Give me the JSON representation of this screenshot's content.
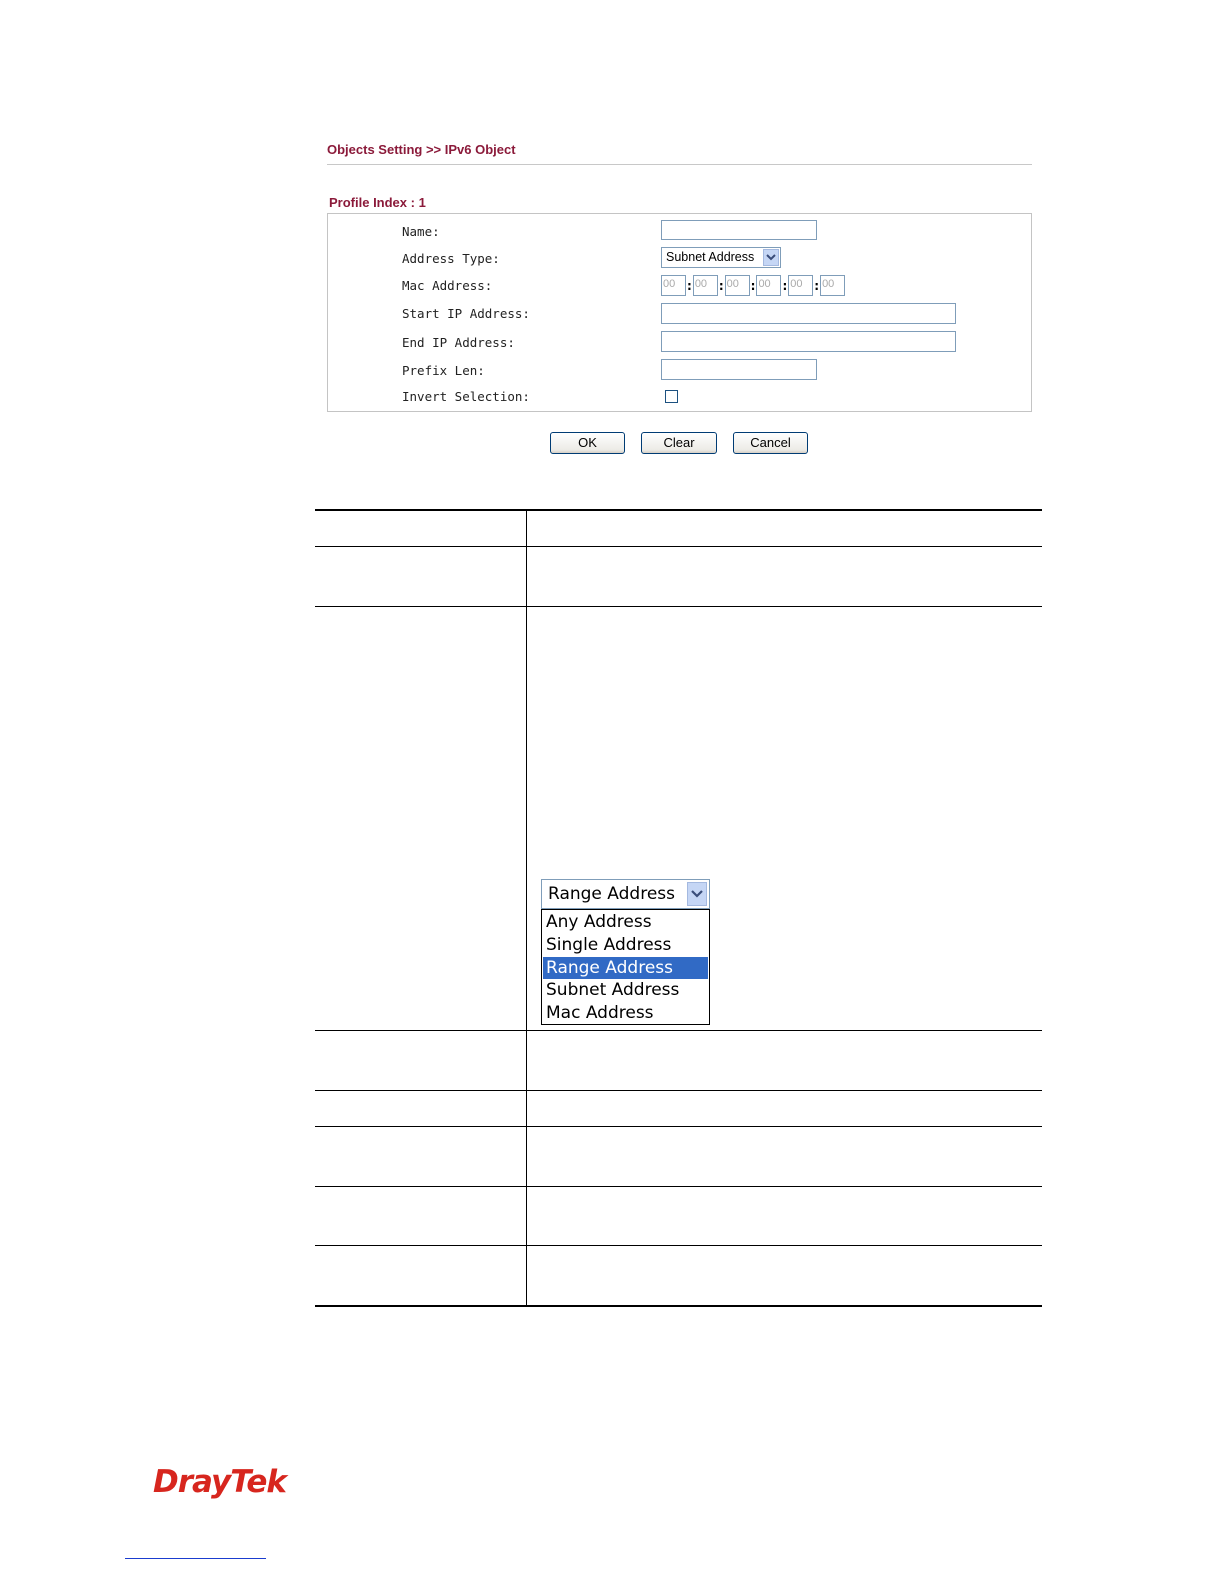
{
  "header": {
    "breadcrumb": "Objects Setting >> IPv6 Object",
    "profile_index": "Profile Index : 1"
  },
  "form": {
    "name_label": "Name:",
    "address_type_label": "Address Type:",
    "address_type_value": "Subnet Address",
    "mac_label": "Mac Address:",
    "mac_octets": [
      "00",
      "00",
      "00",
      "00",
      "00",
      "00"
    ],
    "mac_separator": ":",
    "start_ip_label": "Start IP Address:",
    "end_ip_label": "End IP Address:",
    "prefix_len_label": "Prefix Len:",
    "invert_label": "Invert Selection:",
    "invert_checked": false
  },
  "buttons": {
    "ok": "OK",
    "clear": "Clear",
    "cancel": "Cancel"
  },
  "dropdown": {
    "selected": "Range Address",
    "options": [
      "Any Address",
      "Single Address",
      "Range Address",
      "Subnet Address",
      "Mac Address"
    ],
    "highlighted_index": 2
  },
  "brand": {
    "logo_text": "DrayTek",
    "logo_color": "#d7261e"
  },
  "colors": {
    "heading": "#8b1a3a",
    "selection": "#316ac5"
  }
}
